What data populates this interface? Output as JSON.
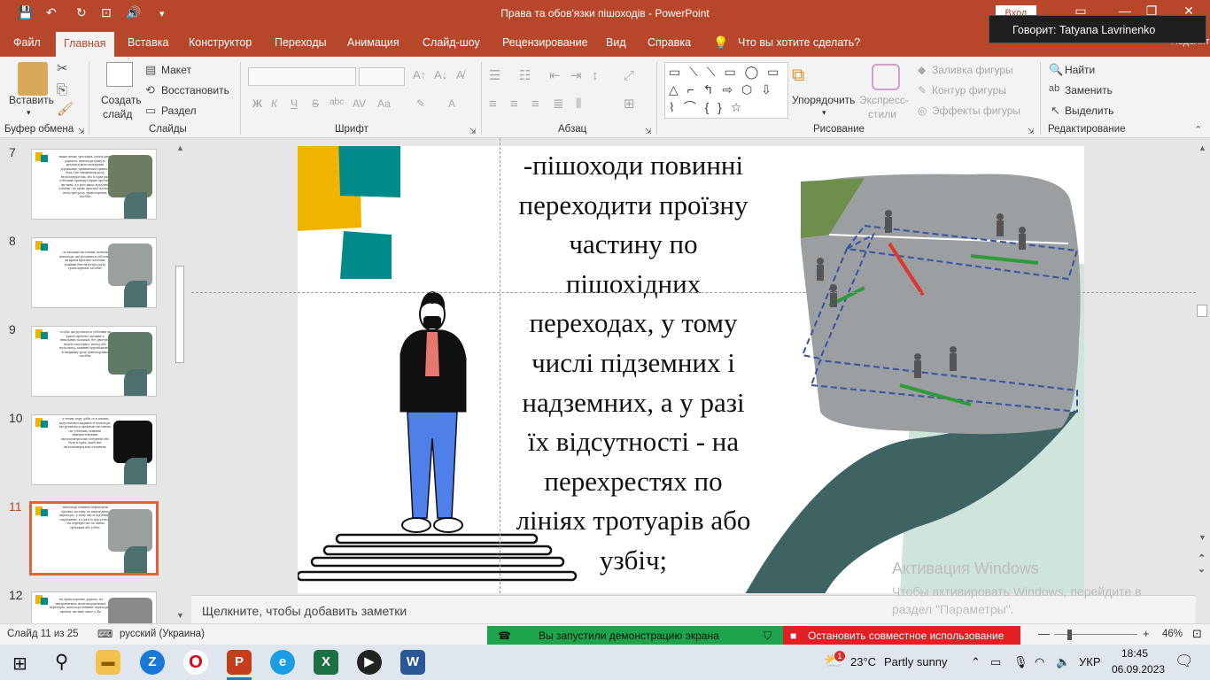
{
  "window": {
    "title": "Права та обов'язки пішоходів  -  PowerPoint",
    "sign_in": "Вход",
    "speaking": "Говорит: Tatyana Lavrinenko",
    "share_partial": "Поделиться"
  },
  "tabs": [
    "Файл",
    "Главная",
    "Вставка",
    "Конструктор",
    "Переходы",
    "Анимация",
    "Слайд-шоу",
    "Рецензирование",
    "Вид",
    "Справка"
  ],
  "tell_me": "Что вы хотите сделать?",
  "ribbon": {
    "clipboard": {
      "paste": "Вставить",
      "label": "Буфер обмена"
    },
    "slides": {
      "new_slide_1": "Создать",
      "new_slide_2": "слайд",
      "layout": "Макет",
      "reset": "Восстановить",
      "section": "Раздел",
      "label": "Слайды"
    },
    "font": {
      "label": "Шрифт",
      "bold": "Ж",
      "italic": "К",
      "underline": "Ч",
      "strike": "S",
      "abc": "abc",
      "case": "Аа"
    },
    "paragraph": {
      "label": "Абзац"
    },
    "drawing": {
      "arrange_1": "Упорядочить",
      "quick_styles_1": "Экспресс-",
      "quick_styles_2": "стили",
      "fill": "Заливка фигуры",
      "outline": "Контур фигуры",
      "effects": "Эффекты фигуры",
      "label": "Рисование"
    },
    "editing": {
      "find": "Найти",
      "replace": "Заменить",
      "select": "Выделить",
      "label": "Редактирование"
    }
  },
  "thumbnails": [
    {
      "num": "7",
      "text": "-якщо немає тротуарів, пішохідних доріжок, пішоходи можуть рухатися велосипедними доріжками, тримаючись правого боку і не створюючи руху велосипедистам, або в один ряд узбіччям, праворуч краю проїзної частини, а у разі якщо відсутній узбіччя - по краю проїзної частини назустріч руху транспортних засобів;"
    },
    {
      "num": "8",
      "text": "-за межами населених пунктів пішоходи, які рухаються узбіччям чи краєм проїзної частини, повинні йти назустріч руху транспортних засобів;"
    },
    {
      "num": "9",
      "text": "-особи, які рухаються узбіччям чи краєм проїзної частини в інвалідних колясках без двигуна, ведуть мотоцикл, мопед або велосипед, повинні переміщатися в напрямку руху транспортних засобів;"
    },
    {
      "num": "10",
      "text": "-у темну пору доби та в умовах недостатньої видимості пішоходи, які рухаються проїзною частиною чи узбіччям, повинні використовувати світлоповертальні елементи або бути в одязі, який має світлоповертальні елементи;"
    },
    {
      "num": "11",
      "text": "-пішоходи повинні переходити проїзну частину по пішохідних переходах, у тому числі підземних і надземних, а у разі їх відсутності - на перехрестях по лініях тротуарів або узбіч;"
    },
    {
      "num": "12",
      "text": "-на транспортних дорогах, на неохраняемых железнодорожных переездах, пішоходи повинні переходити проїзну частину лише у бік"
    }
  ],
  "slide": {
    "lines": [
      "-пішоходи повинні",
      "переходити проїзну",
      "частину по",
      "пішохідних",
      "переходах, у тому",
      "числі підземних і",
      "надземних, а у разі",
      "їх відсутності - на",
      "перехрестях по",
      "лініях тротуарів або",
      "узбіч;"
    ]
  },
  "notes_placeholder": "Щелкните, чтобы добавить заметки",
  "activation": {
    "title": "Активация Windows",
    "subtitle": "Чтобы активировать Windows, перейдите в раздел \"Параметры\"."
  },
  "status": {
    "slide_count": "Слайд 11 из 25",
    "language": "русский (Украина)",
    "share_started": "Вы запустили демонстрацию экрана",
    "stop_share": "Остановить совместное использование",
    "zoom": "46%"
  },
  "taskbar": {
    "weather_temp": "23°C",
    "weather_desc": "Partly sunny",
    "lang": "УКР",
    "time": "18:45",
    "date": "06.09.2023",
    "weather_badge": "1"
  },
  "colors": {
    "accent": "#b7472a",
    "teal": "#008b8b",
    "yellow": "#f0b400",
    "curve": "#3f6362"
  }
}
